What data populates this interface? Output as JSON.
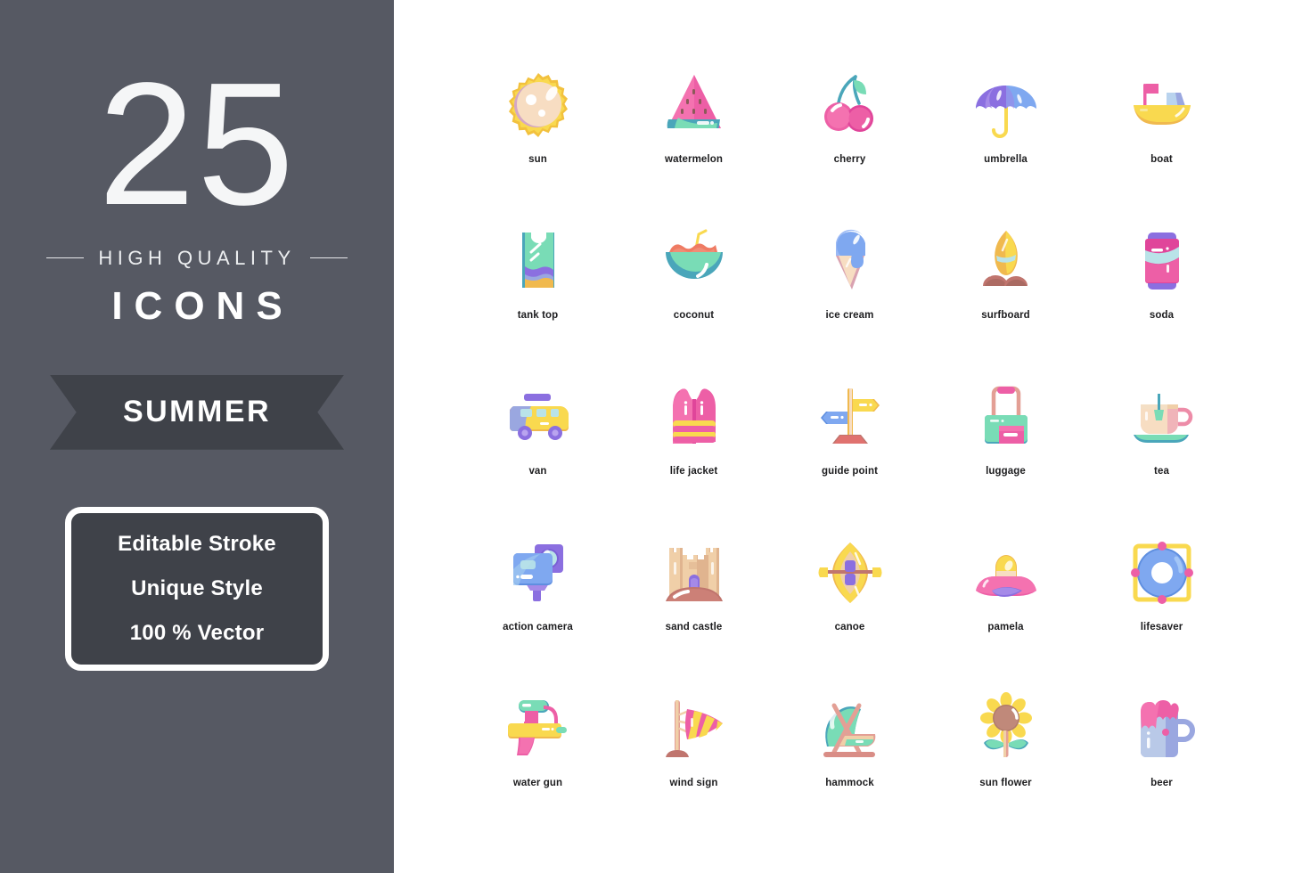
{
  "sidebar": {
    "count": "25",
    "subtitle": "HIGH QUALITY",
    "icons_word": "ICONS",
    "ribbon_label": "SUMMER",
    "info_lines": [
      "Editable Stroke",
      "Unique Style",
      "100 % Vector"
    ],
    "colors": {
      "background": "#565963",
      "ribbon": "#3f4249",
      "infobox_fill": "#3f4249",
      "infobox_border": "#ffffff",
      "text": "#ffffff"
    }
  },
  "grid": {
    "columns": 5,
    "rows": 5,
    "total": 25,
    "background": "#ffffff",
    "label_color": "#1d1d1f",
    "items": [
      {
        "name": "sun",
        "icon": "sun-icon"
      },
      {
        "name": "watermelon",
        "icon": "watermelon-icon"
      },
      {
        "name": "cherry",
        "icon": "cherry-icon"
      },
      {
        "name": "umbrella",
        "icon": "umbrella-icon"
      },
      {
        "name": "boat",
        "icon": "boat-icon"
      },
      {
        "name": "tank top",
        "icon": "tank-top-icon"
      },
      {
        "name": "coconut",
        "icon": "coconut-icon"
      },
      {
        "name": "ice cream",
        "icon": "ice-cream-icon"
      },
      {
        "name": "surfboard",
        "icon": "surfboard-icon"
      },
      {
        "name": "soda",
        "icon": "soda-icon"
      },
      {
        "name": "van",
        "icon": "van-icon"
      },
      {
        "name": "life jacket",
        "icon": "life-jacket-icon"
      },
      {
        "name": "guide point",
        "icon": "guide-point-icon"
      },
      {
        "name": "luggage",
        "icon": "luggage-icon"
      },
      {
        "name": "tea",
        "icon": "tea-icon"
      },
      {
        "name": "action camera",
        "icon": "action-camera-icon"
      },
      {
        "name": "sand castle",
        "icon": "sand-castle-icon"
      },
      {
        "name": "canoe",
        "icon": "canoe-icon"
      },
      {
        "name": "pamela",
        "icon": "pamela-icon"
      },
      {
        "name": "lifesaver",
        "icon": "lifesaver-icon"
      },
      {
        "name": "water gun",
        "icon": "water-gun-icon"
      },
      {
        "name": "wind sign",
        "icon": "wind-sign-icon"
      },
      {
        "name": "hammock",
        "icon": "hammock-icon"
      },
      {
        "name": "sun flower",
        "icon": "sun-flower-icon"
      },
      {
        "name": "beer",
        "icon": "beer-icon"
      }
    ],
    "palette": {
      "yellow": "#f9d94f",
      "yellow_dark": "#f0b94e",
      "pink": "#f06fae",
      "pink_light": "#f58cbc",
      "magenta": "#e8408e",
      "purple": "#8b6fe0",
      "purple_light": "#a58ae8",
      "blue": "#7fa8f0",
      "blue_dark": "#5f8fe0",
      "mint": "#79dcb6",
      "teal": "#4aa6ba",
      "sand": "#f0cfa8",
      "brown": "#c08276",
      "peach": "#f7ddc2"
    }
  }
}
